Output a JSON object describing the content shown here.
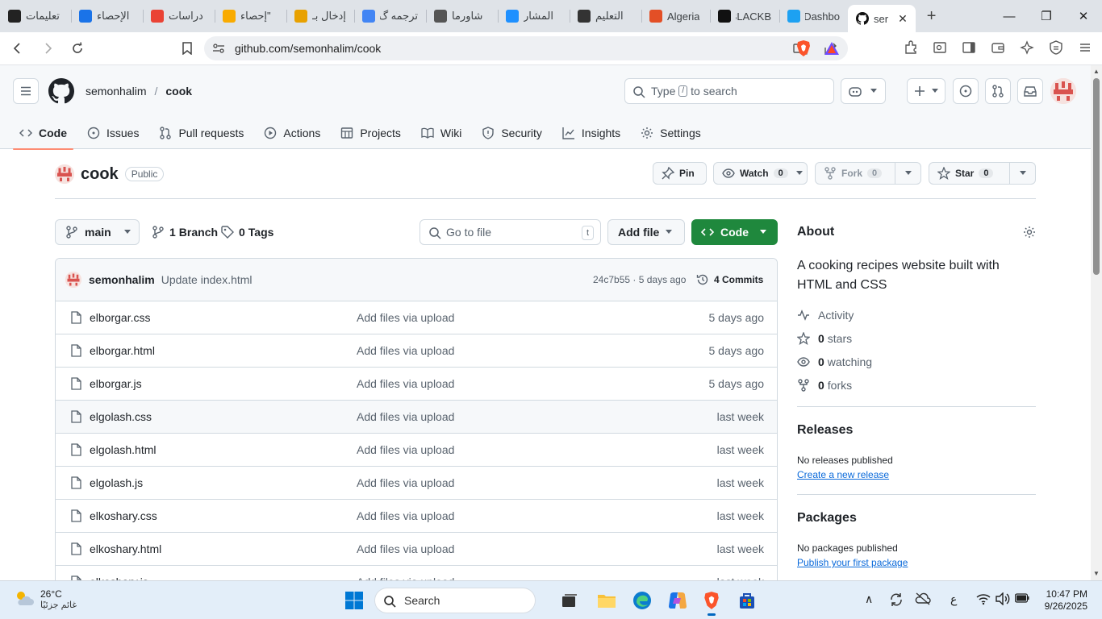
{
  "browser": {
    "tabs": [
      {
        "title": "تعليمات",
        "icon": "openai-icon",
        "color": "#222222"
      },
      {
        "title": "الإحصاء",
        "icon": "bar-chart-icon",
        "color": "#1a73e8"
      },
      {
        "title": "دراسات",
        "icon": "google-icon",
        "color": "#ea4335"
      },
      {
        "title": "\"إحصاء",
        "icon": "analytics-icon",
        "color": "#f9ab00"
      },
      {
        "title": "إدخال بـ",
        "icon": "number-5-icon",
        "color": "#e8a100"
      },
      {
        "title": "ترجمه گ",
        "icon": "google-icon",
        "color": "#4285f4"
      },
      {
        "title": "شاورما",
        "icon": "globe-icon",
        "color": "#555555"
      },
      {
        "title": "المشار",
        "icon": "circle-icon",
        "color": "#1e90ff"
      },
      {
        "title": "التعليم",
        "icon": "person-icon",
        "color": "#333333"
      },
      {
        "title": "Algeria",
        "icon": "star-burst-icon",
        "color": "#e34f26"
      },
      {
        "title": "BLACKB",
        "icon": "terminal-icon",
        "color": "#111111"
      },
      {
        "title": "Dashbo",
        "icon": "bird-icon",
        "color": "#1da1f2"
      }
    ],
    "active_tab": {
      "title": "ser",
      "icon": "github-icon"
    },
    "url": "github.com/semonhalim/cook"
  },
  "header": {
    "owner": "semonhalim",
    "separator": "/",
    "repo": "cook",
    "search_prefix": "Type",
    "search_key": "/",
    "search_suffix": "to search"
  },
  "repo_nav": [
    {
      "label": "Code",
      "icon": "code-icon",
      "active": true
    },
    {
      "label": "Issues",
      "icon": "issue-icon"
    },
    {
      "label": "Pull requests",
      "icon": "pull-request-icon"
    },
    {
      "label": "Actions",
      "icon": "play-icon"
    },
    {
      "label": "Projects",
      "icon": "table-icon"
    },
    {
      "label": "Wiki",
      "icon": "book-icon"
    },
    {
      "label": "Security",
      "icon": "shield-icon"
    },
    {
      "label": "Insights",
      "icon": "graph-icon"
    },
    {
      "label": "Settings",
      "icon": "gear-icon"
    }
  ],
  "repo": {
    "name": "cook",
    "visibility": "Public",
    "pin_label": "Pin",
    "watch_label": "Watch",
    "watch_count": "0",
    "fork_label": "Fork",
    "fork_count": "0",
    "star_label": "Star",
    "star_count": "0"
  },
  "browser_bar": {
    "branch": "main",
    "branch_count": "1",
    "branch_label": "Branch",
    "tag_count": "0",
    "tag_label": "Tags",
    "goto_placeholder": "Go to file",
    "goto_key": "t",
    "add_file_label": "Add file",
    "code_label": "Code"
  },
  "latest_commit": {
    "author": "semonhalim",
    "message": "Update index.html",
    "sha_age": "24c7b55 · 5 days ago",
    "commits_label": "4 Commits"
  },
  "files": [
    {
      "name": "elborgar.css",
      "message": "Add files via upload",
      "date": "5 days ago"
    },
    {
      "name": "elborgar.html",
      "message": "Add files via upload",
      "date": "5 days ago"
    },
    {
      "name": "elborgar.js",
      "message": "Add files via upload",
      "date": "5 days ago"
    },
    {
      "name": "elgolash.css",
      "message": "Add files via upload",
      "date": "last week"
    },
    {
      "name": "elgolash.html",
      "message": "Add files via upload",
      "date": "last week"
    },
    {
      "name": "elgolash.js",
      "message": "Add files via upload",
      "date": "last week"
    },
    {
      "name": "elkoshary.css",
      "message": "Add files via upload",
      "date": "last week"
    },
    {
      "name": "elkoshary.html",
      "message": "Add files via upload",
      "date": "last week"
    },
    {
      "name": "elkoshary.js",
      "message": "Add files via upload",
      "date": "last week"
    }
  ],
  "about": {
    "title": "About",
    "description": "A cooking recipes website built with HTML and CSS",
    "activity_label": "Activity",
    "stars_count": "0",
    "stars_label": "stars",
    "watching_count": "0",
    "watching_label": "watching",
    "forks_count": "0",
    "forks_label": "forks"
  },
  "releases": {
    "title": "Releases",
    "empty": "No releases published",
    "link": "Create a new release"
  },
  "packages": {
    "title": "Packages",
    "empty": "No packages published",
    "link": "Publish your first package"
  },
  "taskbar": {
    "temperature": "26°C",
    "condition": "غائم جزئيًا",
    "search_label": "Search",
    "lang": "ع",
    "time": "10:47 PM",
    "date": "9/26/2025"
  },
  "colors": {
    "accent_green": "#1f883d",
    "link_blue": "#0969da",
    "tab_underline": "#fd8c73"
  }
}
